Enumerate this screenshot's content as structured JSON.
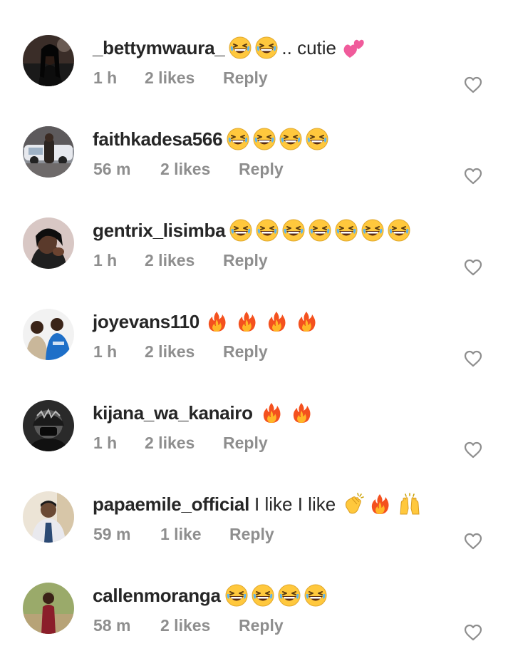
{
  "comments": [
    {
      "username": "_bettymwaura_",
      "text": "",
      "emojis": [
        "grinning-squinting-face",
        "grinning-squinting-face"
      ],
      "after_text": ".. cutie",
      "trailing_emojis": [
        "two-hearts"
      ],
      "time": "1 h",
      "likes": "2 likes",
      "reply": "Reply"
    },
    {
      "username": "faithkadesa566",
      "text": "",
      "emojis": [
        "grinning-squinting-face",
        "grinning-squinting-face",
        "grinning-squinting-face",
        "grinning-squinting-face"
      ],
      "time": "56 m",
      "likes": "2 likes",
      "reply": "Reply"
    },
    {
      "username": "gentrix_lisimba",
      "text": "",
      "emojis": [
        "grinning-squinting-face",
        "grinning-squinting-face",
        "grinning-squinting-face",
        "grinning-squinting-face",
        "grinning-squinting-face",
        "grinning-squinting-face",
        "grinning-squinting-face"
      ],
      "time": "1 h",
      "likes": "2 likes",
      "reply": "Reply"
    },
    {
      "username": "joyevans110",
      "text": "",
      "emojis": [
        "fire",
        "fire",
        "fire",
        "fire"
      ],
      "time": "1 h",
      "likes": "2 likes",
      "reply": "Reply"
    },
    {
      "username": "kijana_wa_kanairo",
      "text": "",
      "emojis": [
        "fire",
        "fire"
      ],
      "time": "1 h",
      "likes": "2 likes",
      "reply": "Reply"
    },
    {
      "username": "papaemile_official",
      "text": "I like I like",
      "emojis": [
        "clapping-hands",
        "fire",
        "raising-hands"
      ],
      "time": "59 m",
      "likes": "1 like",
      "reply": "Reply"
    },
    {
      "username": "callenmoranga",
      "text": "",
      "emojis": [
        "grinning-squinting-face",
        "grinning-squinting-face",
        "grinning-squinting-face",
        "grinning-squinting-face"
      ],
      "time": "58 m",
      "likes": "2 likes",
      "reply": "Reply"
    }
  ],
  "icons": {
    "like": "heart-outline-icon"
  },
  "colors": {
    "username": "#262626",
    "meta": "#8e8e8e",
    "heart_outline": "#8e8e8e",
    "emoji_yellow": "#ffc83d",
    "fire_orange": "#f4511e",
    "hearts_pink": "#f05b9b"
  }
}
